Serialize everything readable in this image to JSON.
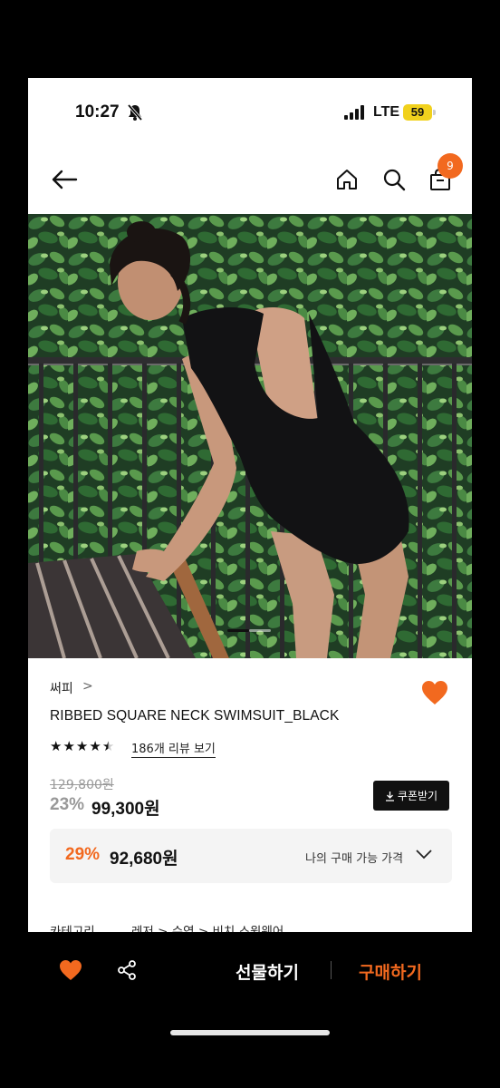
{
  "status_bar": {
    "time": "10:27",
    "network": "LTE",
    "battery": "59"
  },
  "nav": {
    "cart_count": "9"
  },
  "product": {
    "brand": "써피",
    "brand_chevron": ">",
    "name": "RIBBED SQUARE NECK SWIMSUIT_BLACK",
    "rating": 4.5,
    "reviews_label": "186개 리뷰 보기",
    "original_price": "129,800원",
    "discount_percent": "23%",
    "sale_price": "99,300원",
    "coupon_label": "쿠폰받기",
    "my_price": {
      "percent": "29%",
      "price": "92,680원",
      "label": "나의 구매 가능 가격"
    },
    "category": {
      "label": "카테고리",
      "path": "레저 > 수영 > 비치 스윔웨어"
    }
  },
  "bottom_bar": {
    "gift_label": "선물하기",
    "buy_label": "구매하기"
  },
  "colors": {
    "accent": "#f2691f",
    "dark": "#111111"
  },
  "icons": [
    "back-arrow-icon",
    "home-icon",
    "search-icon",
    "shopping-bag-icon",
    "heart-icon",
    "share-icon",
    "download-icon",
    "chevron-down-icon",
    "bell-slash-icon",
    "signal-icon"
  ]
}
